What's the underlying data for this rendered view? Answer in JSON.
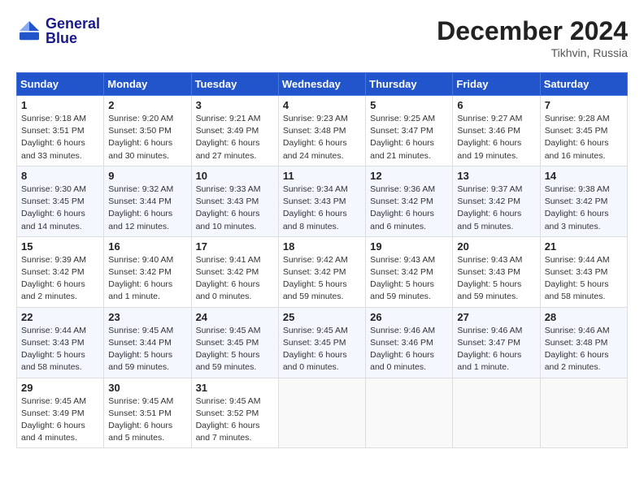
{
  "header": {
    "logo_line1": "General",
    "logo_line2": "Blue",
    "month_title": "December 2024",
    "location": "Tikhvin, Russia"
  },
  "columns": [
    "Sunday",
    "Monday",
    "Tuesday",
    "Wednesday",
    "Thursday",
    "Friday",
    "Saturday"
  ],
  "weeks": [
    [
      {
        "day": "1",
        "sunrise": "9:18 AM",
        "sunset": "3:51 PM",
        "daylight": "6 hours and 33 minutes."
      },
      {
        "day": "2",
        "sunrise": "9:20 AM",
        "sunset": "3:50 PM",
        "daylight": "6 hours and 30 minutes."
      },
      {
        "day": "3",
        "sunrise": "9:21 AM",
        "sunset": "3:49 PM",
        "daylight": "6 hours and 27 minutes."
      },
      {
        "day": "4",
        "sunrise": "9:23 AM",
        "sunset": "3:48 PM",
        "daylight": "6 hours and 24 minutes."
      },
      {
        "day": "5",
        "sunrise": "9:25 AM",
        "sunset": "3:47 PM",
        "daylight": "6 hours and 21 minutes."
      },
      {
        "day": "6",
        "sunrise": "9:27 AM",
        "sunset": "3:46 PM",
        "daylight": "6 hours and 19 minutes."
      },
      {
        "day": "7",
        "sunrise": "9:28 AM",
        "sunset": "3:45 PM",
        "daylight": "6 hours and 16 minutes."
      }
    ],
    [
      {
        "day": "8",
        "sunrise": "9:30 AM",
        "sunset": "3:45 PM",
        "daylight": "6 hours and 14 minutes."
      },
      {
        "day": "9",
        "sunrise": "9:32 AM",
        "sunset": "3:44 PM",
        "daylight": "6 hours and 12 minutes."
      },
      {
        "day": "10",
        "sunrise": "9:33 AM",
        "sunset": "3:43 PM",
        "daylight": "6 hours and 10 minutes."
      },
      {
        "day": "11",
        "sunrise": "9:34 AM",
        "sunset": "3:43 PM",
        "daylight": "6 hours and 8 minutes."
      },
      {
        "day": "12",
        "sunrise": "9:36 AM",
        "sunset": "3:42 PM",
        "daylight": "6 hours and 6 minutes."
      },
      {
        "day": "13",
        "sunrise": "9:37 AM",
        "sunset": "3:42 PM",
        "daylight": "6 hours and 5 minutes."
      },
      {
        "day": "14",
        "sunrise": "9:38 AM",
        "sunset": "3:42 PM",
        "daylight": "6 hours and 3 minutes."
      }
    ],
    [
      {
        "day": "15",
        "sunrise": "9:39 AM",
        "sunset": "3:42 PM",
        "daylight": "6 hours and 2 minutes."
      },
      {
        "day": "16",
        "sunrise": "9:40 AM",
        "sunset": "3:42 PM",
        "daylight": "6 hours and 1 minute."
      },
      {
        "day": "17",
        "sunrise": "9:41 AM",
        "sunset": "3:42 PM",
        "daylight": "6 hours and 0 minutes."
      },
      {
        "day": "18",
        "sunrise": "9:42 AM",
        "sunset": "3:42 PM",
        "daylight": "5 hours and 59 minutes."
      },
      {
        "day": "19",
        "sunrise": "9:43 AM",
        "sunset": "3:42 PM",
        "daylight": "5 hours and 59 minutes."
      },
      {
        "day": "20",
        "sunrise": "9:43 AM",
        "sunset": "3:43 PM",
        "daylight": "5 hours and 59 minutes."
      },
      {
        "day": "21",
        "sunrise": "9:44 AM",
        "sunset": "3:43 PM",
        "daylight": "5 hours and 58 minutes."
      }
    ],
    [
      {
        "day": "22",
        "sunrise": "9:44 AM",
        "sunset": "3:43 PM",
        "daylight": "5 hours and 58 minutes."
      },
      {
        "day": "23",
        "sunrise": "9:45 AM",
        "sunset": "3:44 PM",
        "daylight": "5 hours and 59 minutes."
      },
      {
        "day": "24",
        "sunrise": "9:45 AM",
        "sunset": "3:45 PM",
        "daylight": "5 hours and 59 minutes."
      },
      {
        "day": "25",
        "sunrise": "9:45 AM",
        "sunset": "3:45 PM",
        "daylight": "6 hours and 0 minutes."
      },
      {
        "day": "26",
        "sunrise": "9:46 AM",
        "sunset": "3:46 PM",
        "daylight": "6 hours and 0 minutes."
      },
      {
        "day": "27",
        "sunrise": "9:46 AM",
        "sunset": "3:47 PM",
        "daylight": "6 hours and 1 minute."
      },
      {
        "day": "28",
        "sunrise": "9:46 AM",
        "sunset": "3:48 PM",
        "daylight": "6 hours and 2 minutes."
      }
    ],
    [
      {
        "day": "29",
        "sunrise": "9:45 AM",
        "sunset": "3:49 PM",
        "daylight": "6 hours and 4 minutes."
      },
      {
        "day": "30",
        "sunrise": "9:45 AM",
        "sunset": "3:51 PM",
        "daylight": "6 hours and 5 minutes."
      },
      {
        "day": "31",
        "sunrise": "9:45 AM",
        "sunset": "3:52 PM",
        "daylight": "6 hours and 7 minutes."
      },
      null,
      null,
      null,
      null
    ]
  ]
}
